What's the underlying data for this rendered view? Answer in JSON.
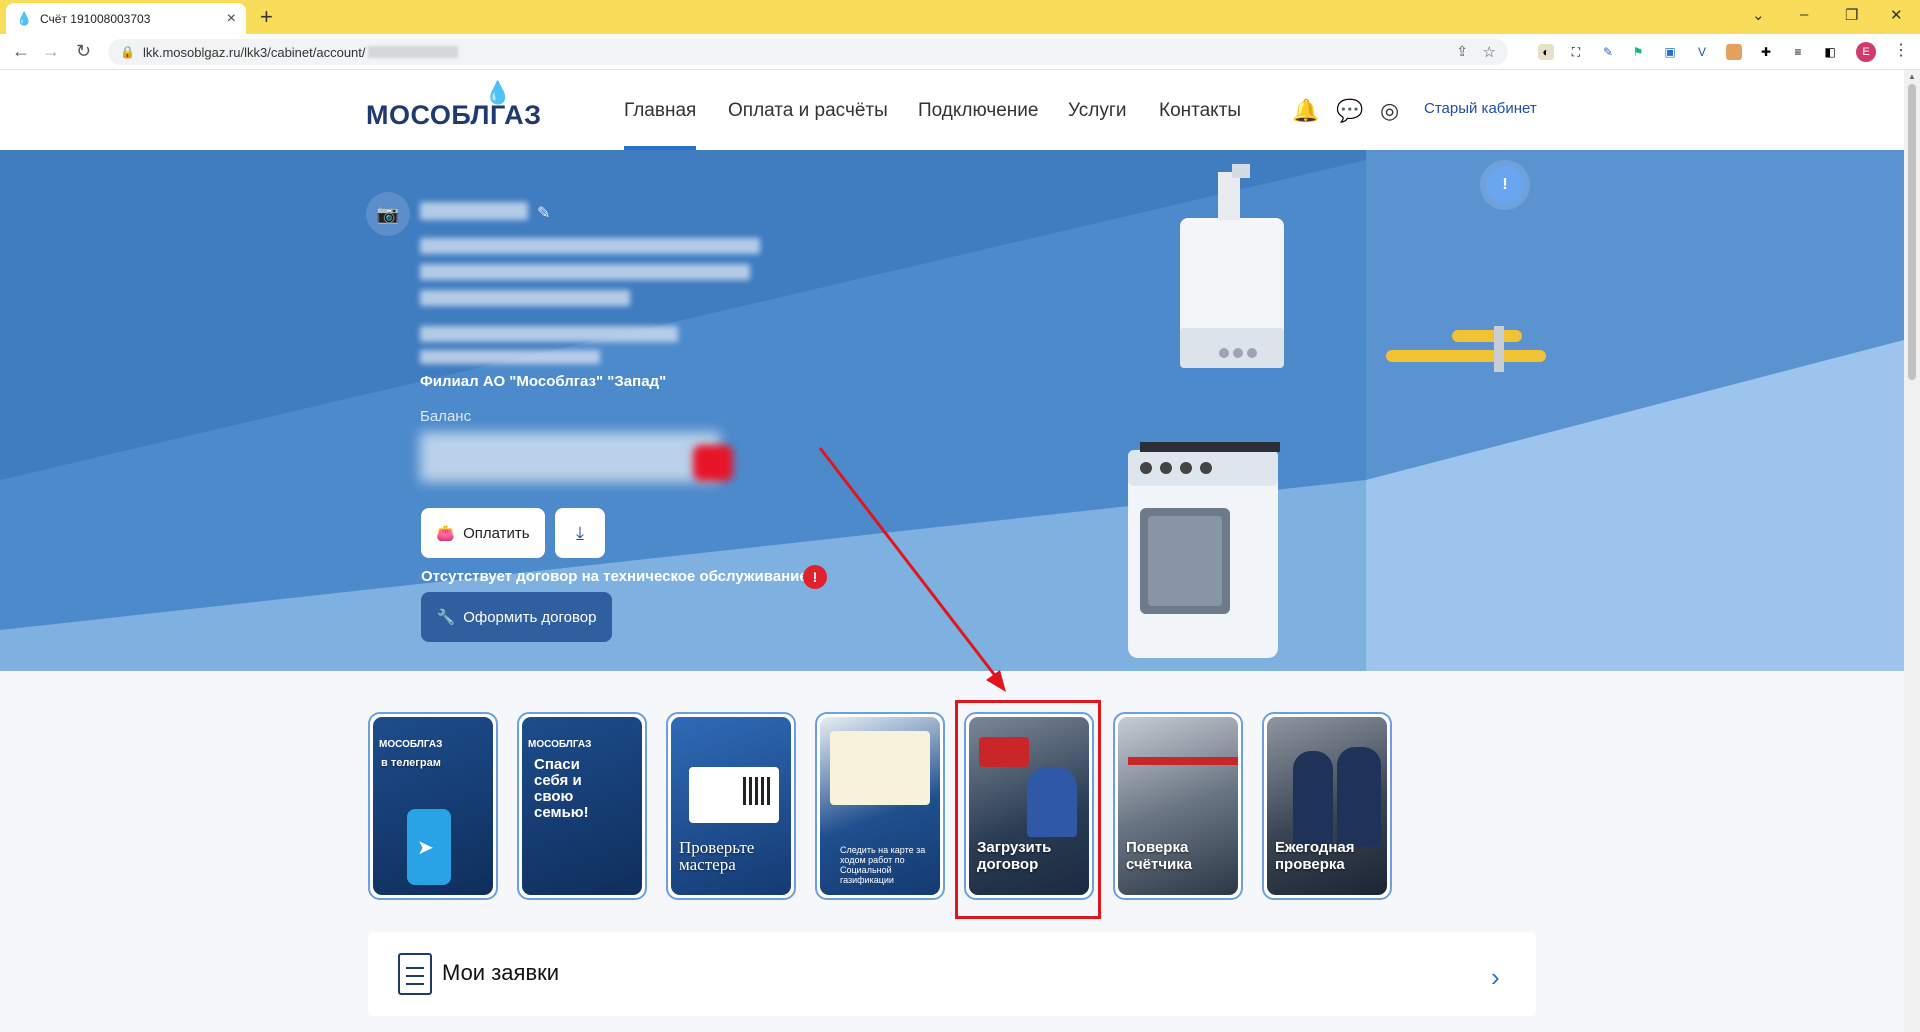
{
  "browser": {
    "tab_title": "Счёт 191008003703",
    "url": "lkk.mosoblgaz.ru/lkk3/cabinet/account/",
    "avatar_letter": "E"
  },
  "header": {
    "logo": "МОСОБЛГАЗ",
    "nav": [
      "Главная",
      "Оплата и расчёты",
      "Подключение",
      "Услуги",
      "Контакты"
    ],
    "old_cabinet": "Старый кабинет"
  },
  "hero": {
    "branch": "Филиал АО \"Мособлгаз\" \"Запад\"",
    "balance_label": "Баланс",
    "pay_label": "Оплатить",
    "no_contract_text": "Отсутствует договор на техническое обслуживание",
    "warning_mark": "!",
    "info_mark": "!",
    "contract_button": "Оформить договор"
  },
  "cards": [
    {
      "top": "МОСОБЛГАЗ",
      "caption": "в телеграм"
    },
    {
      "top": "МОСОБЛГАЗ",
      "caption": "Спаси себя и свою семью!"
    },
    {
      "top": "",
      "caption": "Проверьте мастера"
    },
    {
      "top": "",
      "caption": "Следить на карте за ходом работ по Социальной газификации"
    },
    {
      "top": "",
      "caption": "Загрузить договор"
    },
    {
      "top": "",
      "caption": "Поверка счётчика"
    },
    {
      "top": "",
      "caption": "Ежегодная проверка"
    }
  ],
  "requests": {
    "title": "Мои заявки"
  },
  "colors": {
    "hero_blue": "#3f7cc0",
    "brand_navy": "#1f3a6e",
    "accent_blue": "#2a6fc9",
    "annotation_red": "#e0161c"
  }
}
